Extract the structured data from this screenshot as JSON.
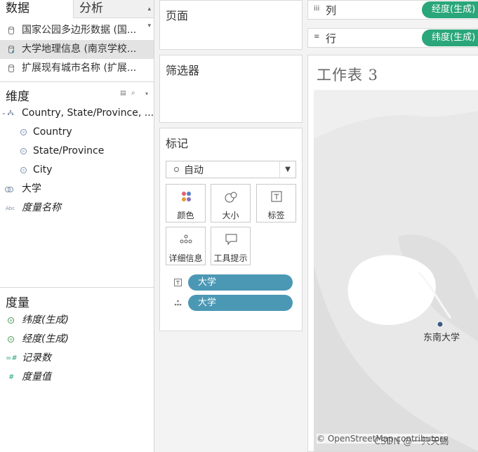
{
  "tabs": {
    "data": "数据",
    "analysis": "分析"
  },
  "datasources": [
    {
      "label": "国家公园多边形数据 (国..."
    },
    {
      "label": "大学地理信息 (南京学校..."
    },
    {
      "label": "扩展现有城市名称 (扩展..."
    }
  ],
  "dimensions": {
    "header": "维度",
    "hierarchy": "Country, State/Province, ...",
    "items": [
      "Country",
      "State/Province",
      "City"
    ],
    "university": "大学",
    "measure_names": "度量名称",
    "abc_icon": "Abc"
  },
  "measures": {
    "header": "度量",
    "items": [
      "纬度(生成)",
      "经度(生成)",
      "记录数",
      "度量值"
    ]
  },
  "cards": {
    "pages": "页面",
    "filters": "筛选器",
    "marks": "标记"
  },
  "marks": {
    "type": "自动",
    "buttons": [
      "颜色",
      "大小",
      "标签",
      "详细信息",
      "工具提示"
    ],
    "pills": [
      "大学",
      "大学"
    ]
  },
  "shelves": {
    "columns_label": "列",
    "columns_pill": "经度(生成)",
    "rows_label": "行",
    "rows_pill": "纬度(生成)"
  },
  "sheet": {
    "title": "工作表 3",
    "point_label": "东南大学",
    "attribution": "© OpenStreetMap contributors",
    "watermark": "CSDN @一只天蝎"
  },
  "colors": {
    "pill_blue": "#4b98b5",
    "pill_green": "#2aa67a",
    "map_land": "#e9e9e9",
    "map_water": "#ffffff",
    "point": "#3d5a80"
  }
}
